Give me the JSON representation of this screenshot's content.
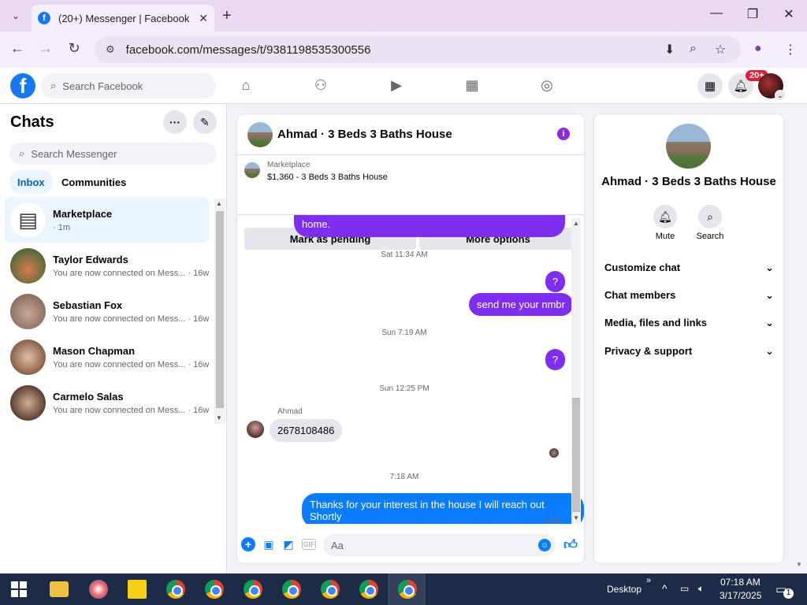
{
  "browser": {
    "tab_title": "(20+) Messenger | Facebook",
    "tab_favicon": "f",
    "url": "facebook.com/messages/t/9381198535300556"
  },
  "fb": {
    "search_placeholder": "Search Facebook",
    "notif_badge": "20+",
    "logo_letter": "f"
  },
  "chats": {
    "title": "Chats",
    "search_placeholder": "Search Messenger",
    "tabs": [
      {
        "label": "Inbox",
        "active": true
      },
      {
        "label": "Communities",
        "active": false
      }
    ],
    "items": [
      {
        "name": "Marketplace",
        "sub": "· 1m",
        "selected": true,
        "color": "#ffffff"
      },
      {
        "name": "Taylor Edwards",
        "sub": "You are now connected on Mess... · 16w",
        "color": "#c0724a"
      },
      {
        "name": "Sebastian Fox",
        "sub": "You are now connected on Mess... · 16w",
        "color": "#b89a88"
      },
      {
        "name": "Mason Chapman",
        "sub": "You are now connected on Mess... · 16w",
        "color": "#caa58a"
      },
      {
        "name": "Carmelo Salas",
        "sub": "You are now connected on Mess... · 16w",
        "color": "#8a6a58"
      }
    ]
  },
  "conversation": {
    "title": "Ahmad · 3 Beds 3 Baths House",
    "marketplace_label": "Marketplace",
    "listing": "$1,360 - 3 Beds 3 Baths House",
    "mark_pending": "Mark as pending",
    "more_options": "More options",
    "partial_message": "home.",
    "ts1": "Sat 11:34 AM",
    "msg_q1": "?",
    "msg_nmbr": "send me your nmbr",
    "ts2": "Sun 7:19 AM",
    "msg_q2": "?",
    "ts3": "Sun 12:25 PM",
    "sender": "Ahmad",
    "msg_phone": "2678108486",
    "ts4": "7:18 AM",
    "msg_thanks": "Thanks for your interest in the house I will reach out Shortly",
    "sent": "Sent",
    "composer_placeholder": "Aa"
  },
  "info": {
    "name": "Ahmad · 3 Beds 3 Baths House",
    "mute": "Mute",
    "search": "Search",
    "sections": [
      "Customize chat",
      "Chat members",
      "Media, files and links",
      "Privacy & support"
    ]
  },
  "taskbar": {
    "desktop": "Desktop",
    "time": "07:18 AM",
    "date": "3/17/2025",
    "notif_count": "1"
  },
  "colors": {
    "fb_blue": "#1877f2",
    "bubble_purple": "#7e2ef0",
    "bubble_blue": "#0a7cff",
    "badge_red": "#e41e3f"
  }
}
